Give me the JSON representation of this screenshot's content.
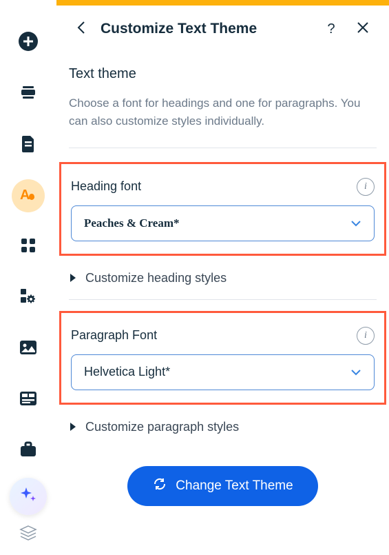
{
  "header": {
    "title": "Customize Text Theme"
  },
  "intro": {
    "section_title": "Text theme",
    "description": "Choose a font for headings and one for paragraphs. You can also customize styles individually."
  },
  "heading_font": {
    "label": "Heading font",
    "value": "Peaches & Cream*"
  },
  "customize_heading": "Customize heading styles",
  "paragraph_font": {
    "label": "Paragraph Font",
    "value": "Helvetica Light*"
  },
  "customize_paragraph": "Customize paragraph styles",
  "cta_label": "Change Text Theme",
  "sidebar": {
    "items": [
      "add",
      "sections",
      "pages",
      "theme",
      "apps",
      "settings",
      "media",
      "blocks",
      "business"
    ]
  }
}
